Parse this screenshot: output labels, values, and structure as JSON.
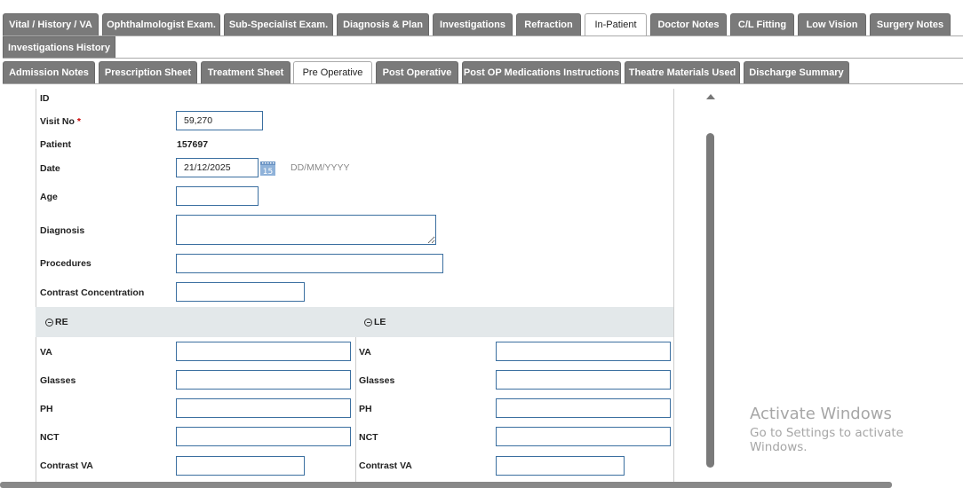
{
  "main_tabs": [
    "Vital / History / VA",
    "Ophthalmologist Exam.",
    "Sub-Specialist Exam.",
    "Diagnosis & Plan",
    "Investigations",
    "Refraction",
    "In-Patient",
    "Doctor Notes",
    "C/L Fitting",
    "Low Vision",
    "Surgery Notes",
    "Investigations History"
  ],
  "main_active": "In-Patient",
  "sub_tabs": [
    "Admission Notes",
    "Prescription Sheet",
    "Treatment Sheet",
    "Pre Operative",
    "Post Operative",
    "Post OP Medications Instructions",
    "Theatre Materials Used",
    "Discharge Summary"
  ],
  "sub_active": "Pre Operative",
  "form": {
    "id_label": "ID",
    "visit_label": "Visit No",
    "required_mark": "*",
    "visit_value": "59,270",
    "patient_label": "Patient",
    "patient_value": "157697",
    "date_label": "Date",
    "date_value": "21/12/2025",
    "calendar_day": "15",
    "date_format": "DD/MM/YYYY",
    "age_label": "Age",
    "age_value": "",
    "diagnosis_label": "Diagnosis",
    "diagnosis_value": "",
    "procedures_label": "Procedures",
    "procedures_value": "",
    "contrast_conc_label": "Contrast Concentration",
    "contrast_conc_value": ""
  },
  "eyes": {
    "re_title": "RE",
    "le_title": "LE",
    "fields": [
      "VA",
      "Glasses",
      "PH",
      "NCT",
      "Contrast VA"
    ]
  },
  "watermark": {
    "title": "Activate Windows",
    "subtitle": "Go to Settings to activate Windows."
  },
  "colors": {
    "tab_bg": "#7a7a7a",
    "input_border": "#3b6fa0",
    "section_bg": "#e3e8ea"
  }
}
